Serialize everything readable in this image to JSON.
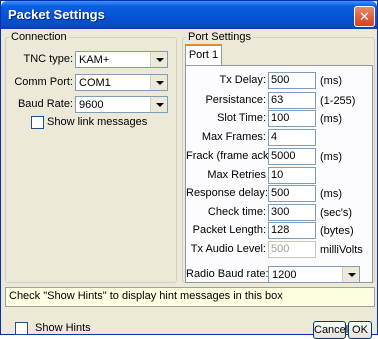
{
  "window": {
    "title": "Packet Settings",
    "close_glyph": "✕"
  },
  "connection": {
    "legend": "Connection",
    "tnc_type": {
      "label": "TNC type:",
      "value": "KAM+"
    },
    "comm_port": {
      "label": "Comm Port:",
      "value": "COM1"
    },
    "baud_rate": {
      "label": "Baud Rate:",
      "value": "9600"
    },
    "show_link_messages": {
      "label": "Show link messages",
      "checked": false
    }
  },
  "port_settings": {
    "legend": "Port Settings",
    "tab": "Port 1",
    "fields": [
      {
        "label": "Tx Delay:",
        "value": "500",
        "unit": "(ms)"
      },
      {
        "label": "Persistance:",
        "value": "63",
        "unit": "(1-255)"
      },
      {
        "label": "Slot Time:",
        "value": "100",
        "unit": "(ms)"
      },
      {
        "label": "Max Frames:",
        "value": "4",
        "unit": ""
      },
      {
        "label": "Frack (frame ack):",
        "value": "5000",
        "unit": "(ms)"
      },
      {
        "label": "Max Retries",
        "value": "10",
        "unit": ""
      },
      {
        "label": "Response delay:",
        "value": "500",
        "unit": "(ms)"
      },
      {
        "label": "Check time:",
        "value": "300",
        "unit": "(sec's)"
      },
      {
        "label": "Packet Length:",
        "value": "128",
        "unit": "(bytes)"
      },
      {
        "label": "Tx Audio Level:",
        "value": "500",
        "unit": "milliVolts",
        "disabled": true
      }
    ],
    "radio_baud_rate": {
      "label": "Radio Baud rate:",
      "value": "1200"
    }
  },
  "hint_text": "Check \"Show Hints\" to display hint messages in this box",
  "footer": {
    "show_hints": {
      "label": "Show Hints",
      "checked": false
    },
    "cancel_label": "Cancel",
    "ok_label": "OK"
  },
  "colors": {
    "title_bar": "#0552d6",
    "face": "#ece9d8",
    "hint_background": "#ffffe1"
  }
}
